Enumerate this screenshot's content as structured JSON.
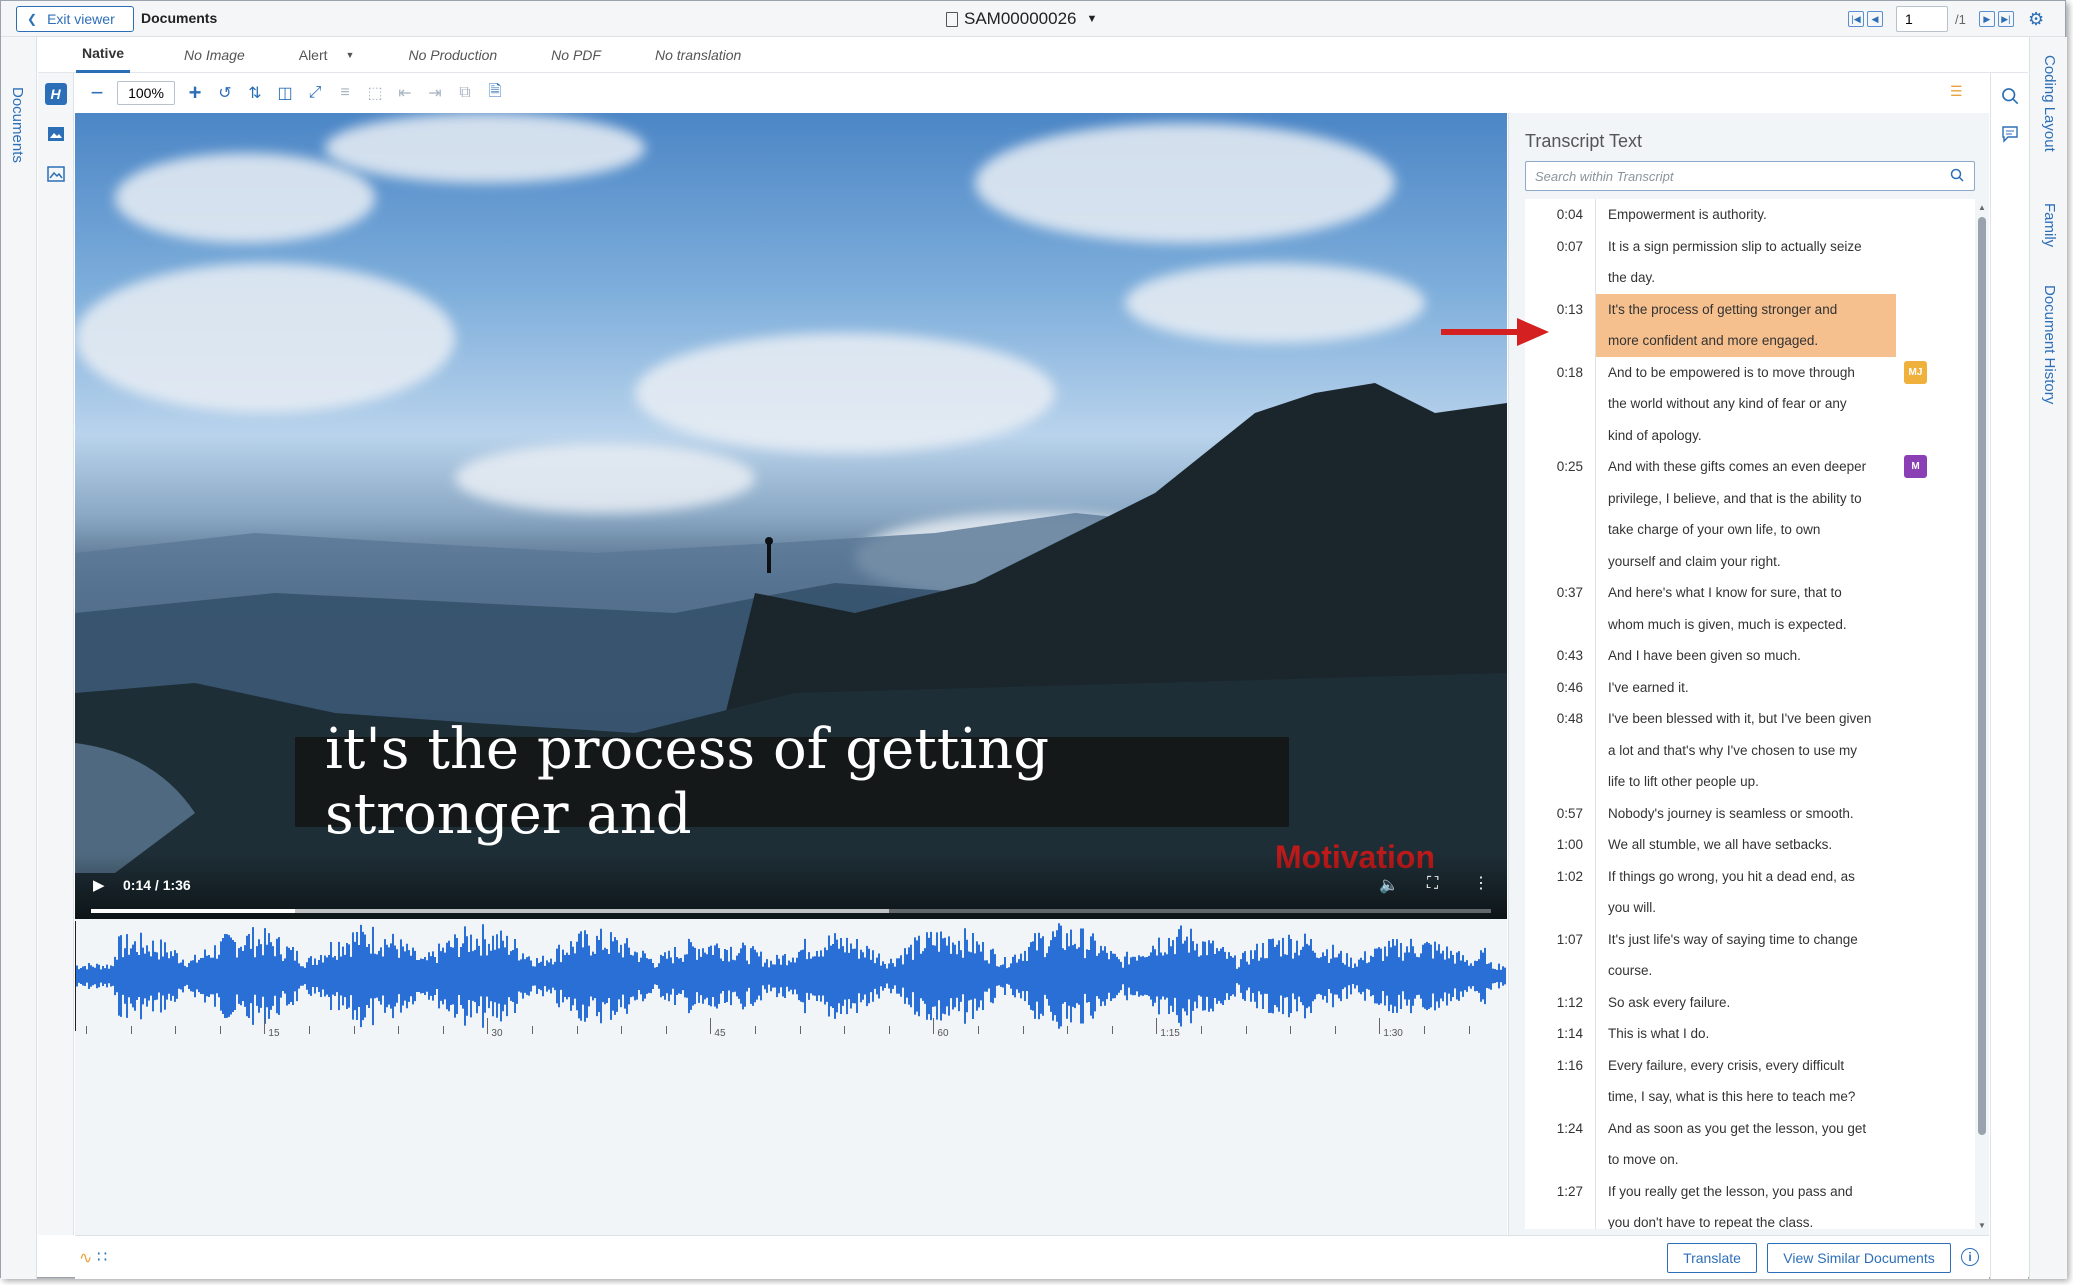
{
  "header": {
    "exit_label": "Exit viewer",
    "section_title": "Documents",
    "document_id": "SAM00000026",
    "page_value": "1",
    "page_total": "/1"
  },
  "rails": {
    "left_label": "Documents",
    "right_items": [
      "Coding Layout",
      "Family",
      "Document History"
    ]
  },
  "tabs": [
    {
      "label": "Native",
      "active": true
    },
    {
      "label": "No Image"
    },
    {
      "label": "Alert"
    },
    {
      "label": "No Production"
    },
    {
      "label": "No PDF"
    },
    {
      "label": "No translation"
    }
  ],
  "toolbar": {
    "zoom_value": "100%"
  },
  "video": {
    "subtitle": "it's the process of getting stronger and",
    "watermark": "Motivation",
    "time": "0:14 / 1:36",
    "progress_fraction": 0.146,
    "buffered_fraction": 0.57
  },
  "timeline": {
    "ticks": [
      "15",
      "30",
      "45",
      "60",
      "1:15",
      "1:30"
    ]
  },
  "transcript": {
    "title": "Transcript Text",
    "search_placeholder": "Search within Transcript",
    "rows": [
      {
        "time": "0:04",
        "lines": [
          "Empowerment is authority."
        ]
      },
      {
        "time": "0:07",
        "lines": [
          "It is a sign permission slip to actually seize",
          "the day."
        ]
      },
      {
        "time": "0:13",
        "lines": [
          "It's the process of getting stronger and",
          "more confident and more engaged."
        ],
        "highlighted": true
      },
      {
        "time": "0:18",
        "lines": [
          "And to be empowered is to move through",
          "the world without any kind of fear or any",
          "kind of apology."
        ],
        "badge": "MJ",
        "badge_color": "#f0b03c"
      },
      {
        "time": "0:25",
        "lines": [
          "And with these gifts comes an even deeper",
          "privilege, I believe, and that is the ability to",
          "take charge of your own life, to own",
          "yourself and claim your right."
        ],
        "badge": "M",
        "badge_color": "#8b3fb5"
      },
      {
        "time": "0:37",
        "lines": [
          "And here's what I know for sure, that to",
          "whom much is given, much is expected."
        ]
      },
      {
        "time": "0:43",
        "lines": [
          "And I have been given so much."
        ]
      },
      {
        "time": "0:46",
        "lines": [
          "I've earned it."
        ]
      },
      {
        "time": "0:48",
        "lines": [
          "I've been blessed with it, but I've been given",
          "a lot and that's why I've chosen to use my",
          "life to lift other people up."
        ]
      },
      {
        "time": "0:57",
        "lines": [
          "Nobody's journey is seamless or smooth."
        ]
      },
      {
        "time": "1:00",
        "lines": [
          "We all stumble, we all have setbacks."
        ]
      },
      {
        "time": "1:02",
        "lines": [
          "If things go wrong, you hit a dead end, as",
          "you will."
        ]
      },
      {
        "time": "1:07",
        "lines": [
          "It's just life's way of saying time to change",
          "course."
        ]
      },
      {
        "time": "1:12",
        "lines": [
          "So ask every failure."
        ]
      },
      {
        "time": "1:14",
        "lines": [
          "This is what I do."
        ]
      },
      {
        "time": "1:16",
        "lines": [
          "Every failure, every crisis, every difficult",
          "time, I say, what is this here to teach me?"
        ]
      },
      {
        "time": "1:24",
        "lines": [
          "And as soon as you get the lesson, you get",
          "to move on."
        ]
      },
      {
        "time": "1:27",
        "lines": [
          "If you really get the lesson, you pass and",
          "you don't have to repeat the class."
        ]
      }
    ]
  },
  "footer": {
    "translate_label": "Translate",
    "similar_label": "View Similar Documents"
  },
  "colors": {
    "accent": "#2d6fb7",
    "highlight": "#f6c08e",
    "waveform": "#2a6fd6",
    "annotation_arrow": "#d42020"
  }
}
